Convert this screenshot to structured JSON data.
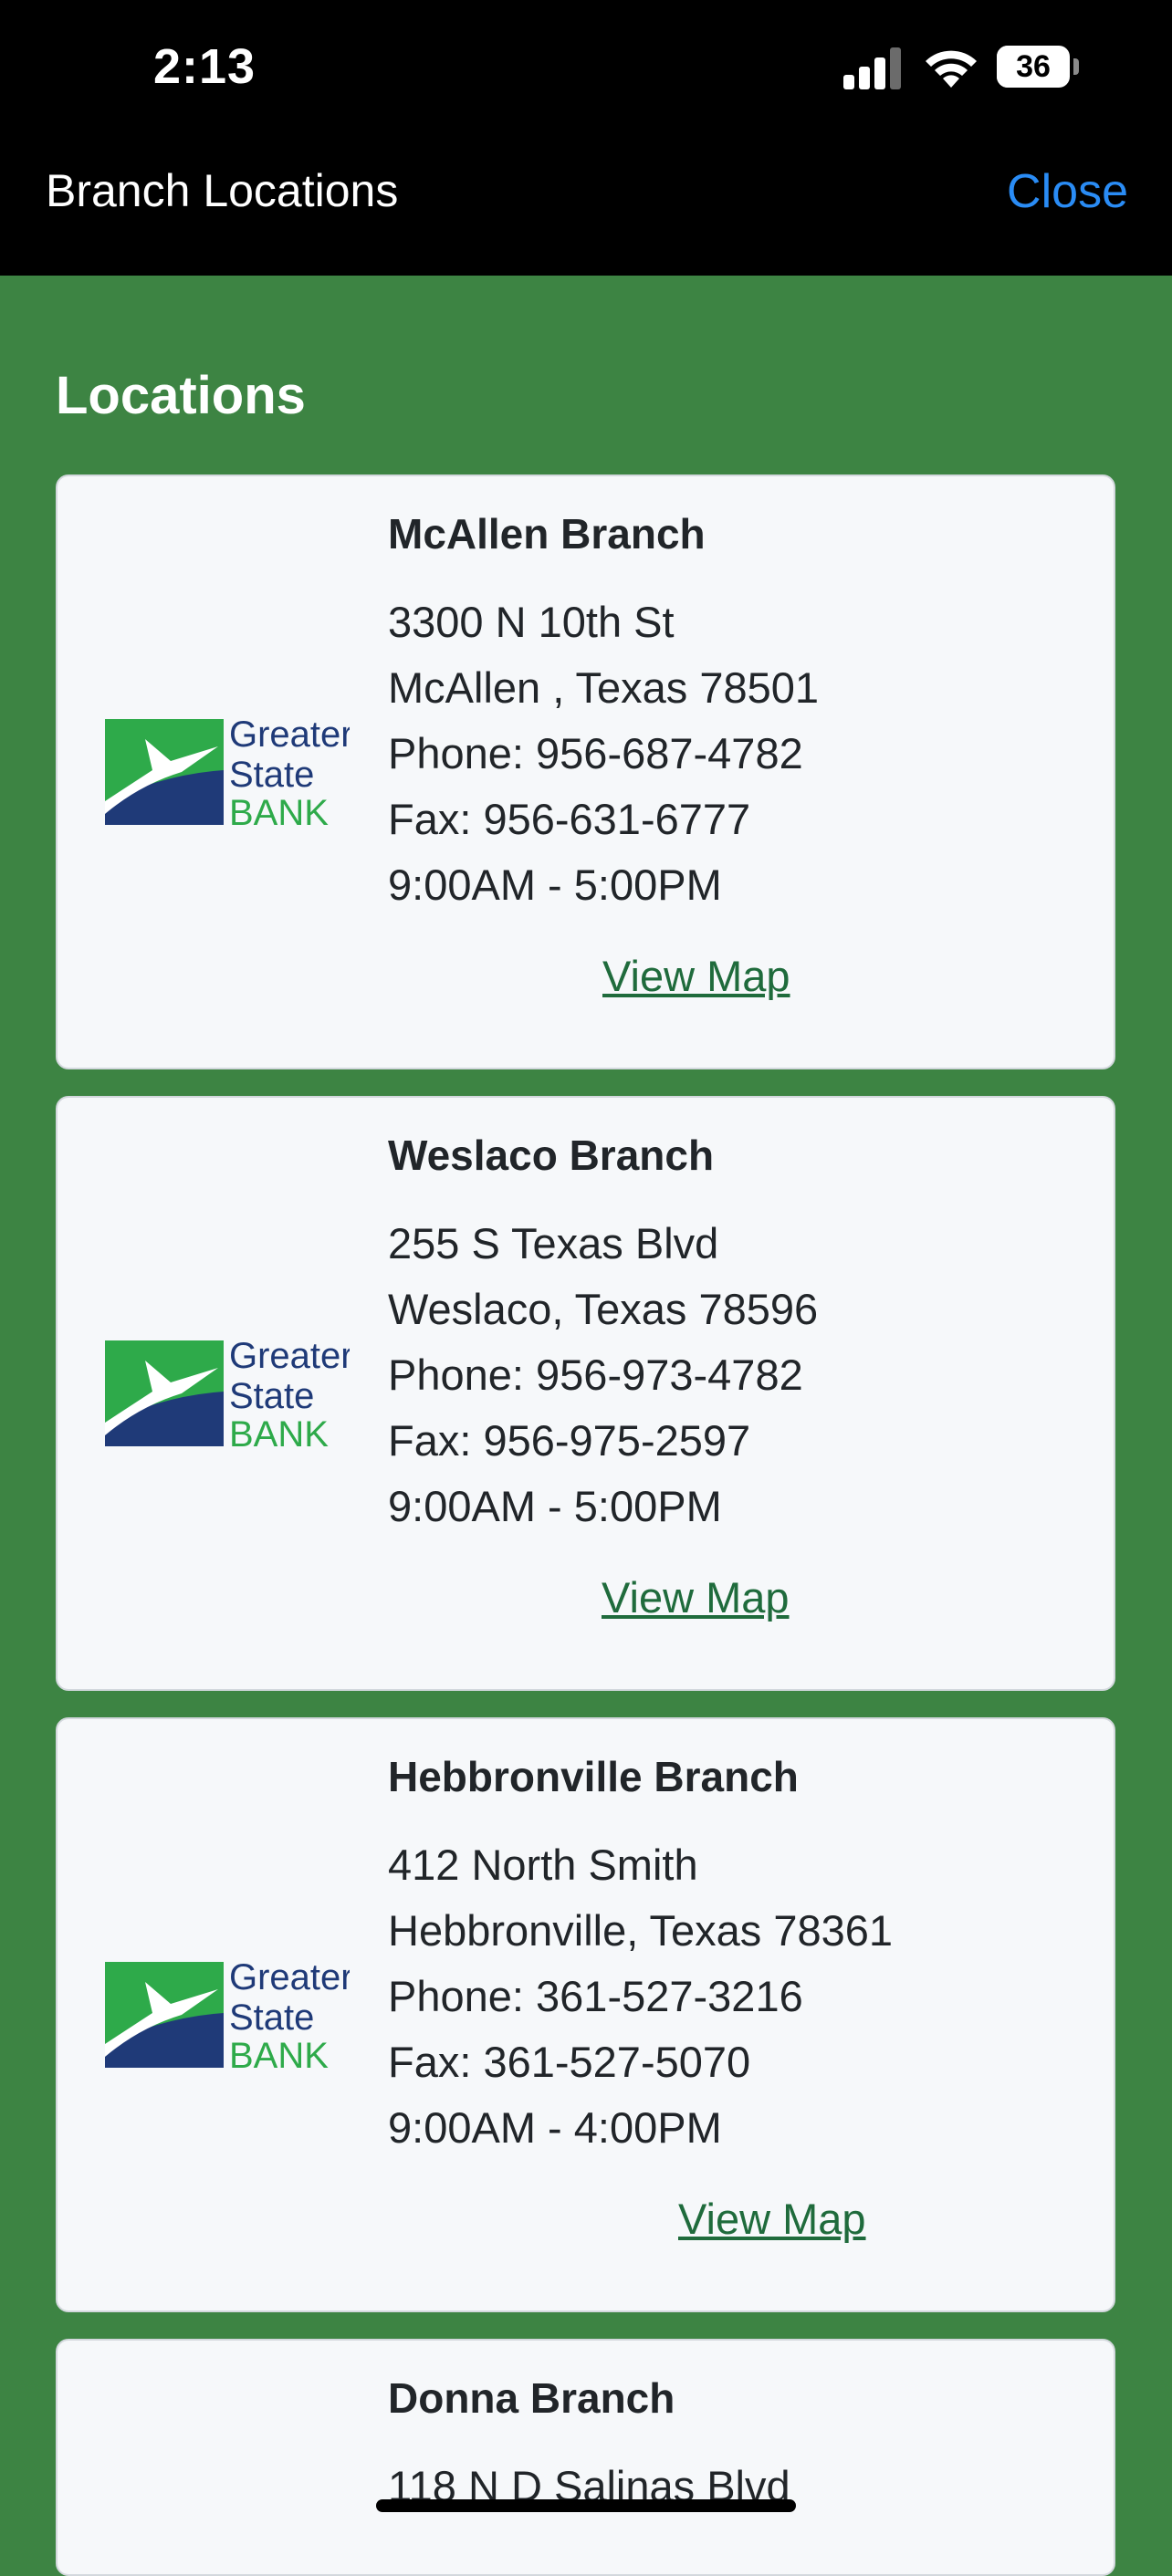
{
  "status_bar": {
    "time": "2:13",
    "battery_level": "36"
  },
  "nav": {
    "title": "Branch Locations",
    "close_label": "Close"
  },
  "section_title": "Locations",
  "logo": {
    "line1": "Greater",
    "line2": "State",
    "line3": "BANK"
  },
  "branches": [
    {
      "name": "McAllen Branch",
      "address": "3300 N 10th St",
      "city": "McAllen , Texas 78501",
      "phone": "Phone: 956-687-4782",
      "fax": "Fax: 956-631-6777",
      "hours": "9:00AM - 5:00PM",
      "map_label": "View Map"
    },
    {
      "name": "Weslaco Branch",
      "address": "255 S Texas Blvd",
      "city": "Weslaco, Texas 78596",
      "phone": "Phone: 956-973-4782",
      "fax": "Fax: 956-975-2597",
      "hours": "9:00AM - 5:00PM",
      "map_label": "View Map"
    },
    {
      "name": "Hebbronville Branch",
      "address": "412 North Smith",
      "city": "Hebbronville, Texas 78361",
      "phone": "Phone: 361-527-3216",
      "fax": "Fax: 361-527-5070",
      "hours": "9:00AM - 4:00PM",
      "map_label": "View Map"
    },
    {
      "name": "Donna Branch",
      "address": "118 N D Salinas Blvd"
    }
  ],
  "colors": {
    "background": "#3d8443",
    "link": "#1f6b3c",
    "close": "#2a8cf5",
    "logo_green": "#2eaa4a",
    "logo_navy": "#1f3a78"
  }
}
